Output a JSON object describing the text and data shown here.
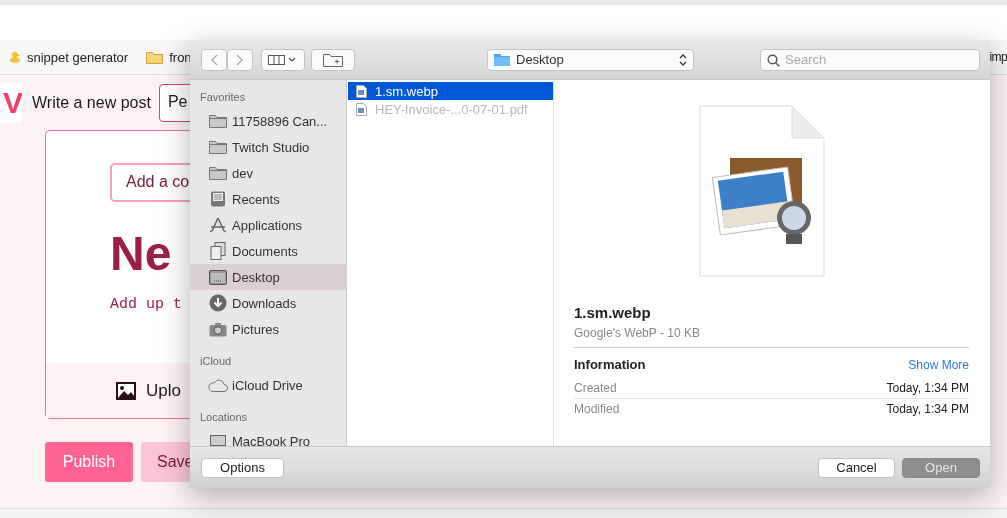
{
  "bookmarks": [
    {
      "label": "snippet generator",
      "kind": "duck"
    },
    {
      "label": "fron",
      "kind": "folder"
    },
    {
      "label": "imp",
      "kind": "plain"
    }
  ],
  "page": {
    "logo": "V",
    "heading": "Write a new post",
    "mode_field": "Pe",
    "cover_button": "Add a co",
    "title_placeholder": "Ne",
    "tags_placeholder": "Add up t",
    "upload": "Uplo",
    "buttons": [
      {
        "label": "Publish",
        "kind": "primary"
      },
      {
        "label": "Save",
        "kind": "secondary"
      }
    ]
  },
  "dialog": {
    "location": "Desktop",
    "search": {
      "placeholder": "Search"
    },
    "sidebar": [
      {
        "title": "Favorites",
        "items": [
          {
            "label": "11758896 Can...",
            "kind": "folder",
            "selected": false
          },
          {
            "label": "Twitch Studio",
            "kind": "folder",
            "selected": false
          },
          {
            "label": "dev",
            "kind": "folder",
            "selected": false
          },
          {
            "label": "Recents",
            "kind": "recents",
            "selected": false
          },
          {
            "label": "Applications",
            "kind": "applications",
            "selected": false
          },
          {
            "label": "Documents",
            "kind": "documents",
            "selected": false
          },
          {
            "label": "Desktop",
            "kind": "desktop",
            "selected": true
          },
          {
            "label": "Downloads",
            "kind": "downloads",
            "selected": false
          },
          {
            "label": "Pictures",
            "kind": "pictures",
            "selected": false
          }
        ]
      },
      {
        "title": "iCloud",
        "items": [
          {
            "label": "iCloud Drive",
            "kind": "cloud",
            "selected": false
          }
        ]
      },
      {
        "title": "Locations",
        "items": [
          {
            "label": "MacBook Pro",
            "kind": "laptop",
            "selected": false
          }
        ]
      }
    ],
    "files": [
      {
        "name": "1.sm.webp",
        "selected": true,
        "disabled": false
      },
      {
        "name": "HEY-Invoice-...0-07-01.pdf",
        "selected": false,
        "disabled": true
      }
    ],
    "preview": {
      "name": "1.sm.webp",
      "subtitle": "Google's WebP - 10 KB",
      "section": "Information",
      "link": "Show More",
      "rows": [
        {
          "label": "Created",
          "value": "Today, 1:34 PM"
        },
        {
          "label": "Modified",
          "value": "Today, 1:34 PM"
        }
      ]
    },
    "buttons": {
      "options": "Options",
      "cancel": "Cancel",
      "open": "Open"
    }
  }
}
